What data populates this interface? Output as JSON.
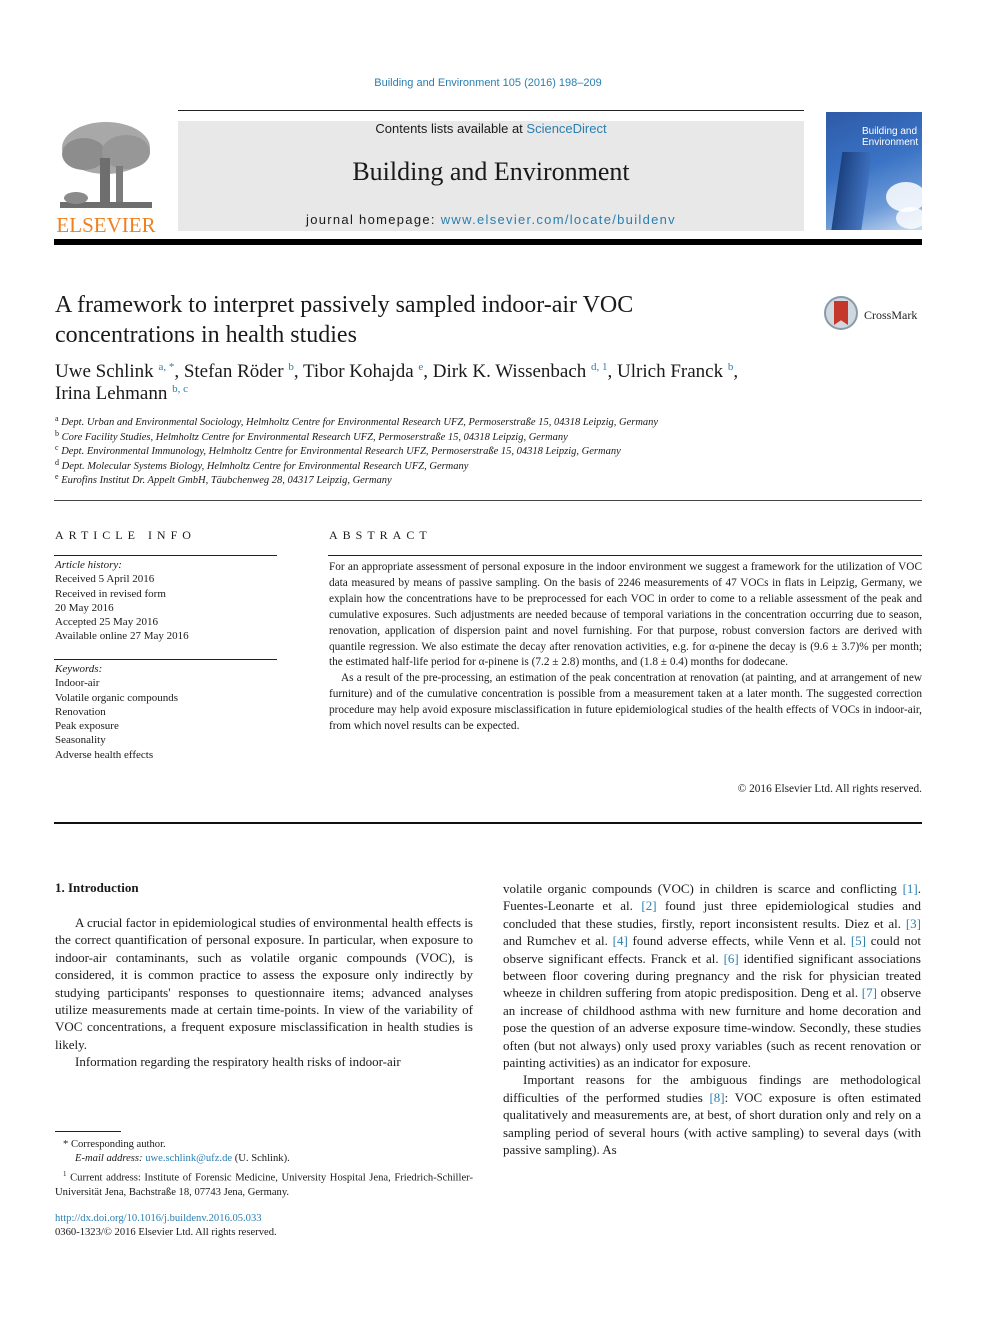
{
  "header": {
    "journal_ref": "Building and Environment 105 (2016) 198–209",
    "contents_prefix": "Contents lists available at ",
    "contents_link": "ScienceDirect",
    "journal_title": "Building and Environment",
    "homepage_prefix": "journal homepage: ",
    "homepage_link": "www.elsevier.com/locate/buildenv",
    "publisher_logo_text": "ELSEVIER",
    "cover_title_line1": "Building and",
    "cover_title_line2": "Environment",
    "crossmark_label": "CrossMark"
  },
  "article": {
    "title": "A framework to interpret passively sampled indoor-air VOC concentrations in health studies",
    "authors": [
      {
        "name": "Uwe Schlink",
        "sup": "a, *",
        "sep": ", "
      },
      {
        "name": "Stefan Röder",
        "sup": "b",
        "sep": ", "
      },
      {
        "name": "Tibor Kohajda",
        "sup": "e",
        "sep": ", "
      },
      {
        "name": "Dirk K. Wissenbach",
        "sup": "d, 1",
        "sep": ", "
      },
      {
        "name": "Ulrich Franck",
        "sup": "b",
        "sep": ","
      },
      {
        "name": "Irina Lehmann",
        "sup": "b, c",
        "sep": ""
      }
    ],
    "affiliations": [
      {
        "key": "a",
        "text": "Dept. Urban and Environmental Sociology, Helmholtz Centre for Environmental Research UFZ, Permoserstraße 15, 04318 Leipzig, Germany"
      },
      {
        "key": "b",
        "text": "Core Facility Studies, Helmholtz Centre for Environmental Research UFZ, Permoserstraße 15, 04318 Leipzig, Germany"
      },
      {
        "key": "c",
        "text": "Dept. Environmental Immunology, Helmholtz Centre for Environmental Research UFZ, Permoserstraße 15, 04318 Leipzig, Germany"
      },
      {
        "key": "d",
        "text": "Dept. Molecular Systems Biology, Helmholtz Centre for Environmental Research UFZ, Germany"
      },
      {
        "key": "e",
        "text": "Eurofins Institut Dr. Appelt GmbH, Täubchenweg 28, 04317 Leipzig, Germany"
      }
    ]
  },
  "article_info": {
    "heading": "ARTICLE INFO",
    "history_label": "Article history:",
    "history": [
      "Received 5 April 2016",
      "Received in revised form",
      "20 May 2016",
      "Accepted 25 May 2016",
      "Available online 27 May 2016"
    ],
    "keywords_label": "Keywords:",
    "keywords": [
      "Indoor-air",
      "Volatile organic compounds",
      "Renovation",
      "Peak exposure",
      "Seasonality",
      "Adverse health effects"
    ]
  },
  "abstract": {
    "heading": "ABSTRACT",
    "p1": "For an appropriate assessment of personal exposure in the indoor environment we suggest a framework for the utilization of VOC data measured by means of passive sampling. On the basis of 2246 mea­surements of 47 VOCs in flats in Leipzig, Germany, we explain how the concentrations have to be pre­processed for each VOC in order to come to a reliable assessment of the peak and cumulative expo­sures. Such adjustments are needed because of temporal variations in the concentration occurring due to season, renovation, application of dispersion paint and novel furnishing. For that purpose, robust con­version factors are derived with quantile regression. We also estimate the decay after renovation ac­tivities, e.g. for α-pinene the decay is (9.6 ± 3.7)% per month; the estimated half-life period for α-pinene is (7.2 ± 2.8) months, and (1.8 ± 0.4) months for dodecane.",
    "p2": "As a result of the pre-processing, an estimation of the peak concentration at renovation (at painting, and at arrangement of new furniture) and of the cumulative concentration is possible from a mea­surement taken at a later month. The suggested correction procedure may help avoid exposure misclassification in future epidemiological studies of the health effects of VOCs in indoor-air, from which novel results can be expected.",
    "copyright": "© 2016 Elsevier Ltd. All rights reserved."
  },
  "body": {
    "section_title": "1.  Introduction",
    "left_p1": "A crucial factor in epidemiological studies of environmental health effects is the correct quantification of personal exposure. In particular, when exposure to indoor-air contaminants, such as volatile organic compounds (VOC), is considered, it is common practice to assess the exposure only indirectly by studying partic­ipants' responses to questionnaire items; advanced analyses utilize measurements made at certain time-points. In view of the vari­ability of VOC concentrations, a frequent exposure misclassification in health studies is likely.",
    "left_p2": "Information regarding the respiratory health risks of indoor-air",
    "right_segments": [
      {
        "t": "volatile organic compounds (VOC) in children is scarce and con­flicting "
      },
      {
        "c": "[1]"
      },
      {
        "t": ". Fuentes-Leonarte et al. "
      },
      {
        "c": "[2]"
      },
      {
        "t": " found just three epidemio­logical studies and concluded that these studies, firstly, report inconsistent results. Diez et al. "
      },
      {
        "c": "[3]"
      },
      {
        "t": " and Rumchev et al. "
      },
      {
        "c": "[4]"
      },
      {
        "t": " found adverse effects, while Venn et al. "
      },
      {
        "c": "[5]"
      },
      {
        "t": " could not observe significant effects. Franck et al. "
      },
      {
        "c": "[6]"
      },
      {
        "t": " identified significant associations between floor covering during pregnancy and the risk for physician treated wheeze in children suffering from atopic predisposition. Deng et al. "
      },
      {
        "c": "[7]"
      },
      {
        "t": " observe an increase of childhood asthma with new furniture and home decoration and pose the question of an adverse exposure time-window. Secondly, these studies often (but not always) only used proxy variables (such as recent renovation or painting activ­ities) as an indicator for exposure."
      }
    ],
    "right_p2_segments": [
      {
        "t": "Important reasons for the ambiguous findings are methodo­logical difficulties of the performed studies "
      },
      {
        "c": "[8]"
      },
      {
        "t": ": VOC exposure is often estimated qualitatively and measurements are, at best, of short duration only and rely on a sampling period of several hours (with active sampling) to several days (with passive sampling). As"
      }
    ]
  },
  "footnotes": {
    "corresponding": "* Corresponding author.",
    "email_label": "E-mail address: ",
    "email": "uwe.schlink@ufz.de",
    "email_suffix": " (U. Schlink).",
    "note1_mark": "1",
    "note1": " Current address: Institute of Forensic Medicine, University Hospital Jena, Frie­drich-Schiller-Universität Jena, Bachstraße 18, 07743 Jena, Germany.",
    "doi": "http://dx.doi.org/10.1016/j.buildenv.2016.05.033",
    "issn": "0360-1323/© 2016 Elsevier Ltd. All rights reserved."
  }
}
